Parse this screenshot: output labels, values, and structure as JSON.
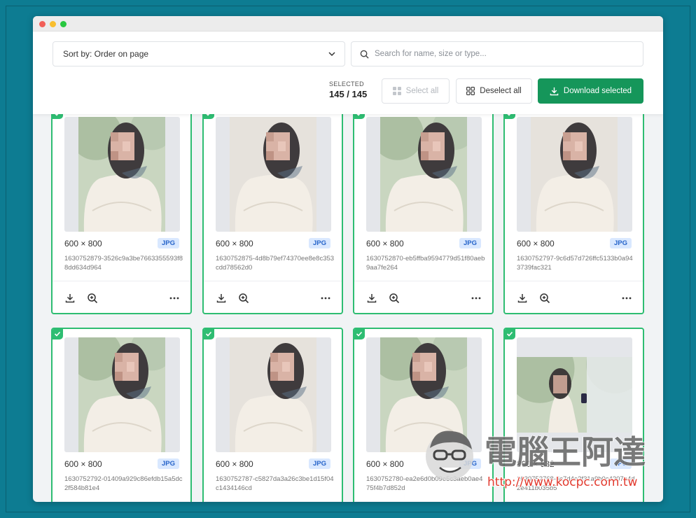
{
  "window": {
    "controls": [
      "close",
      "minimize",
      "maximize"
    ]
  },
  "header": {
    "sort_label": "Sort by: Order on page",
    "search_placeholder": "Search for name, size or type...",
    "selected_label": "SELECTED",
    "selected_value": "145 / 145",
    "select_all_label": "Select all",
    "deselect_all_label": "Deselect all",
    "download_label": "Download selected"
  },
  "colors": {
    "accent_green": "#15965a",
    "card_border": "#2ebd72",
    "badge_bg": "#d9e8ff",
    "badge_text": "#2563c9",
    "page_bg": "#0d7c92"
  },
  "cards": [
    {
      "dims": "600 × 800",
      "type": "JPG",
      "name": "1630752879-3526c9a3be7663355593f88dd634d964"
    },
    {
      "dims": "600 × 800",
      "type": "JPG",
      "name": "1630752875-4d8b79ef74370ee8e8c353cdd78562d0"
    },
    {
      "dims": "600 × 800",
      "type": "JPG",
      "name": "1630752870-eb5ffba9594779d51f80aeb9aa7fe264"
    },
    {
      "dims": "600 × 800",
      "type": "JPG",
      "name": "1630752797-9c6d57d726ffc5133b0a943739fac321"
    },
    {
      "dims": "600 × 800",
      "type": "JPG",
      "name": "1630752792-01409a929c86efdb15a5dc2f584b81e4"
    },
    {
      "dims": "600 × 800",
      "type": "JPG",
      "name": "1630752787-c5827da3a26c3be1d15f04c1434146cd"
    },
    {
      "dims": "600 × 800",
      "type": "JPG",
      "name": "1630752780-ea2e6d0b09e5c3aeb0ae475f4b7d852d"
    },
    {
      "dims": "800 × 532",
      "type": "JPG",
      "name": "1630752768-6c7d4e2f31a9b0c4207a4d2e411b035b5"
    }
  ],
  "watermark": {
    "text": "電腦王阿達",
    "url": "http://www.kocpc.com.tw"
  },
  "icons": {
    "sort_chevron": "chevron-down-icon",
    "search": "search-icon",
    "select_all": "grid-icon",
    "deselect_all": "grid-outline-icon",
    "download": "download-icon",
    "check": "check-icon",
    "card_download": "download-icon",
    "card_zoom": "zoom-in-icon",
    "card_more": "more-icon"
  }
}
